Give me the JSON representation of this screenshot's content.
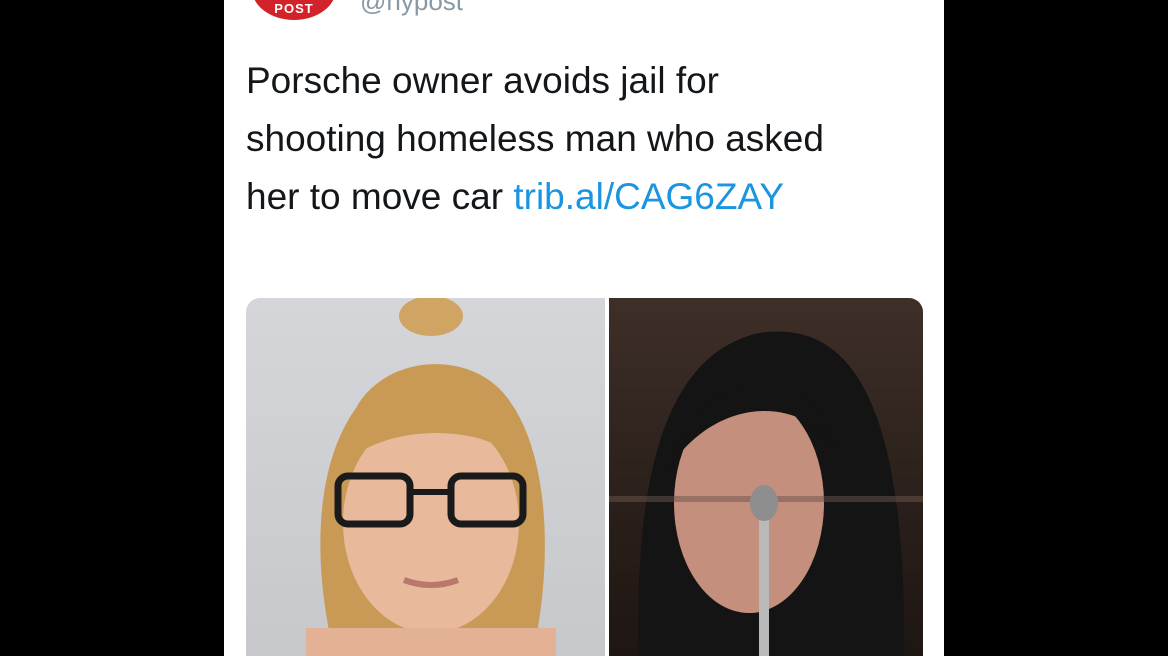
{
  "account": {
    "avatar_label": "POST",
    "handle": "@nypost"
  },
  "tweet": {
    "text": "Porsche owner avoids jail for shooting homeless man who asked her to move car ",
    "link_text": "trib.al/CAG6ZAY"
  },
  "media": {
    "left_image": "mugshot-photo",
    "right_image": "courtroom-photo"
  },
  "colors": {
    "background": "#000000",
    "card": "#ffffff",
    "text": "#14171a",
    "link": "#1b95e0",
    "handle": "#8899a6",
    "avatar": "#d2232a"
  }
}
